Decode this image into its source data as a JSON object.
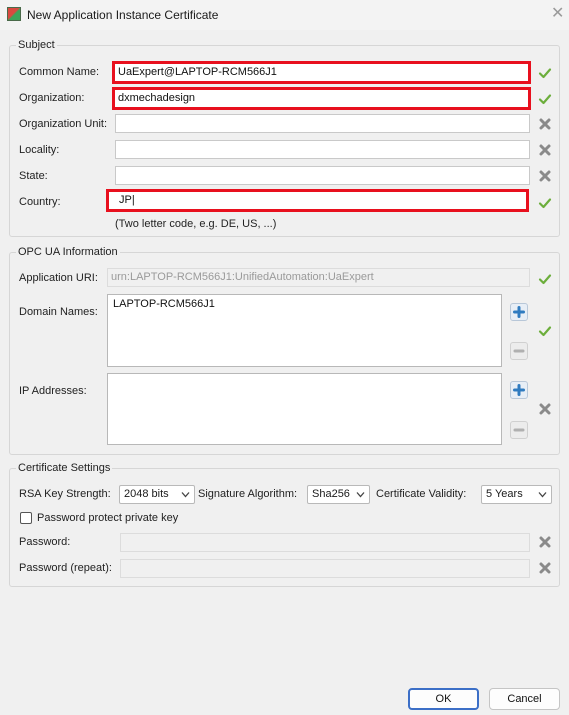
{
  "window": {
    "title": "New Application Instance Certificate",
    "close_glyph": "✕"
  },
  "subject": {
    "legend": "Subject",
    "fields": [
      {
        "label": "Common Name:",
        "value": "UaExpert@LAPTOP-RCM566J1",
        "status": "ok"
      },
      {
        "label": "Organization:",
        "value": "dxmechadesign",
        "status": "ok"
      },
      {
        "label": "Organization Unit:",
        "value": "",
        "status": "error"
      },
      {
        "label": "Locality:",
        "value": "",
        "status": "error"
      },
      {
        "label": "State:",
        "value": "",
        "status": "error"
      },
      {
        "label": "Country:",
        "value": "JP|",
        "status": "ok"
      }
    ],
    "country_hint": "(Two letter code, e.g. DE, US, ...)"
  },
  "opcua": {
    "legend": "OPC UA Information",
    "app_uri_label": "Application URI:",
    "app_uri_value": "urn:LAPTOP-RCM566J1:UnifiedAutomation:UaExpert",
    "domain_names_label": "Domain Names:",
    "domain_names_value": "LAPTOP-RCM566J1",
    "ip_addresses_label": "IP Addresses:",
    "ip_addresses_value": ""
  },
  "cert": {
    "legend": "Certificate Settings",
    "rsa_label": "RSA Key Strength:",
    "rsa_value": "2048 bits",
    "sig_label": "Signature Algorithm:",
    "sig_value": "Sha256",
    "validity_label": "Certificate Validity:",
    "validity_value": "5 Years",
    "protect_label": "Password protect private key",
    "protect_checked": false,
    "password_label": "Password:",
    "password_repeat_label": "Password (repeat):"
  },
  "buttons": {
    "ok": "OK",
    "cancel": "Cancel"
  },
  "colors": {
    "ok_green": "#6cae3c",
    "error_gray": "#8a8a8a",
    "highlight_red": "#e8101e",
    "accent_blue": "#3c6fc7"
  }
}
